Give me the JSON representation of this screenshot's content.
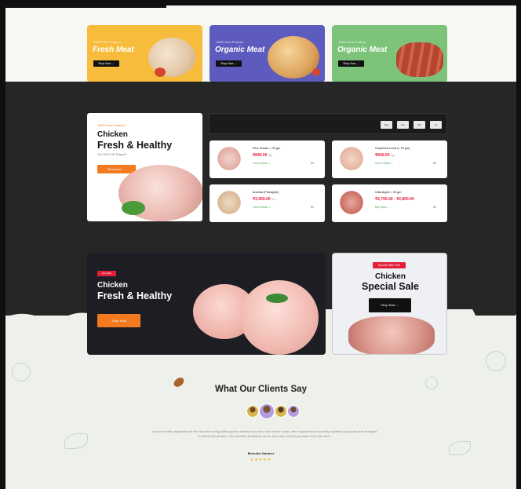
{
  "banners": [
    {
      "tag": "100% Pure Product",
      "title": "Fresh Meat",
      "button": "Shop Now →",
      "color": "#f7bc3c"
    },
    {
      "tag": "100% Pure Product",
      "title": "Organic Meat",
      "button": "Shop Now →",
      "color": "#5d5bbd"
    },
    {
      "tag": "100% Pure Product",
      "title": "Organic Meat",
      "button": "Shop Now →",
      "color": "#7dc47a"
    }
  ],
  "promo": {
    "tag": "100% Pure Product",
    "line1": "Chicken",
    "line2": "Fresh & Healthy",
    "sub": "Get 50% Off Today!!!",
    "button": "Shop Now →"
  },
  "pager": [
    "Day",
    "Hrs",
    "Min",
    "Sc"
  ],
  "products": [
    {
      "name": "Red Tomato × 33 gm",
      "price": "₹840.00",
      "unit": "/kg",
      "stock": "Out of Stock ✓",
      "origin": "IN"
    },
    {
      "name": "Grapefruit Local (× 30 gm)",
      "price": "₹840.00",
      "unit": "/kg",
      "stock": "Out of Stock ✓",
      "origin": "IN"
    },
    {
      "name": "Ananas (Pineapple)",
      "price": "₹3,569.00",
      "unit": "₹4,...",
      "stock": "Out of Stock ✓",
      "origin": "IN"
    },
    {
      "name": "Gala Apple × 33 gm",
      "price": "₹2,700.00 - ₹2,800.00",
      "unit": "/kg",
      "stock": "Buy Now ✓",
      "origin": "IN"
    }
  ],
  "bigbanner": {
    "badge": "Get Offer",
    "line1": "Chicken",
    "line2": "Fresh & Healthy",
    "button": "Shop Now"
  },
  "sale": {
    "badge": "Special Offer 20%",
    "line1": "Chicken",
    "line2": "Special Sale",
    "button": "Shop Now →"
  },
  "testimonials": {
    "heading": "What Our Clients Say",
    "quote": "I want to order vegetables for the first time at Big! Although the delivery was done out of their scope, their support team honestly replied to my query and arranged to deliver the product. The sensitive behaviour we do love was our first purchase from this store.",
    "author": "Benedict Gardner",
    "stars": "★★★★★"
  },
  "colors": {
    "accent": "#f47a1f",
    "price": "#e31f3a",
    "stock": "#4aa44f",
    "dark": "#262626"
  }
}
